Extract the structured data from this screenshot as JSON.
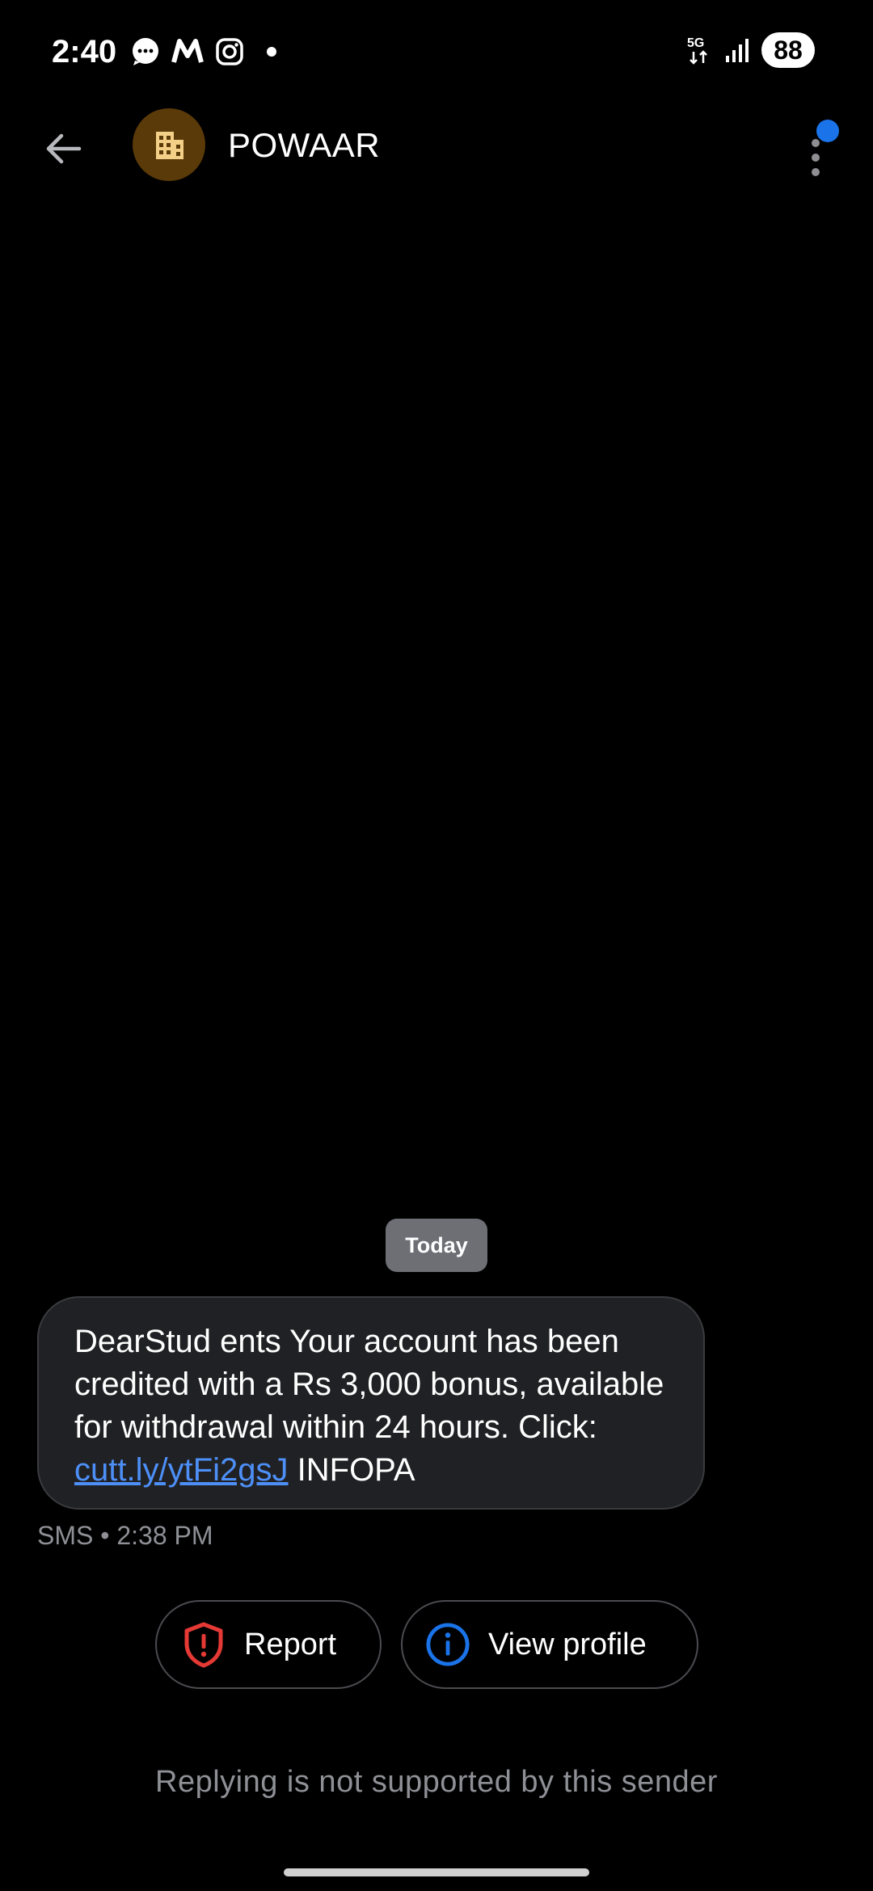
{
  "status_bar": {
    "time": "2:40",
    "network": "5G",
    "battery": "88",
    "icons": [
      "messages-icon",
      "myntra-icon",
      "instagram-icon",
      "dot-icon",
      "5g-icon",
      "signal-icon",
      "battery-icon"
    ]
  },
  "app_bar": {
    "contact_name": "POWAAR",
    "avatar_icon": "building-icon",
    "avatar_color": "#5a3a08",
    "notification_color": "#1a73e8"
  },
  "conversation": {
    "date_chip": "Today",
    "message": {
      "text_before_link": "DearStud ents Your account has been credited with a Rs 3,000 bonus, available for withdrawal within 24 hours. Click: ",
      "link": "cutt.ly/ytFi2gsJ",
      "text_after_link": " INFOPA",
      "meta": "SMS • 2:38 PM"
    }
  },
  "actions": {
    "report_label": "Report",
    "view_profile_label": "View profile",
    "report_color": "#e53935",
    "info_color": "#1a73e8"
  },
  "footer": {
    "reply_note": "Replying is not supported by this sender"
  }
}
